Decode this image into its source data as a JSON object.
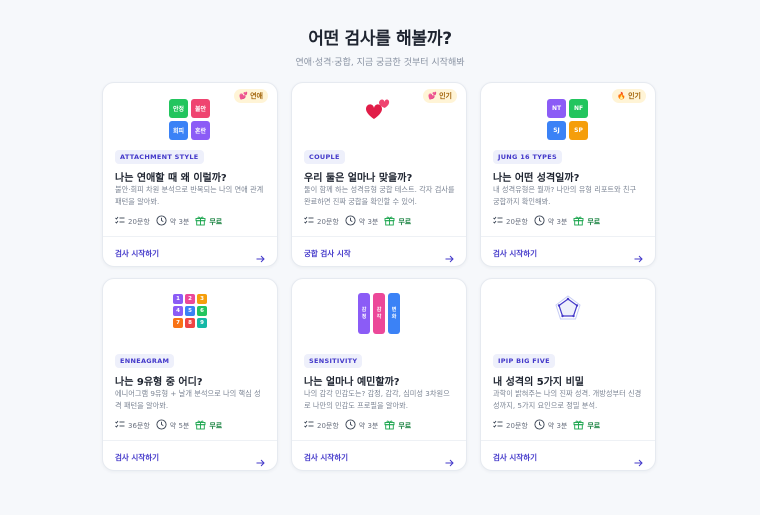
{
  "header": {
    "title": "어떤 검사를 해볼까?",
    "subtitle": "연애·성격·궁합, 지금 궁금한 것부터 시작해봐"
  },
  "colors": {
    "accent": "#4338ca",
    "free": "#15803d",
    "badge_bg": "#fff4d6"
  },
  "cards": [
    {
      "badge": "💕 연애",
      "art_icon": "attachment-grid-icon",
      "art_labels": [
        "안정",
        "불안",
        "회피",
        "혼란"
      ],
      "tag": "ATTACHMENT STYLE",
      "title": "나는 연애할 때 왜 이럴까?",
      "desc": "불안·회피 차원 분석으로 반복되는 나의 연애 관계 패턴을 알아봐.",
      "questions": "20문항",
      "time": "약 3분",
      "price": "무료",
      "cta": "검사 시작하기"
    },
    {
      "badge": "💕 인기",
      "art_icon": "two-hearts-icon",
      "tag": "COUPLE",
      "title": "우리 둘은 얼마나 맞을까?",
      "desc": "둘이 함께 하는 성격유형 궁합 테스트. 각자 검사를 완료하면 진짜 궁합을 확인할 수 있어.",
      "questions": "20문항",
      "time": "약 3분",
      "price": "무료",
      "cta": "궁합 검사 시작"
    },
    {
      "badge": "🔥 인기",
      "art_icon": "jung-grid-icon",
      "art_labels": [
        "NT",
        "NF",
        "SJ",
        "SP"
      ],
      "tag": "JUNG 16 TYPES",
      "title": "나는 어떤 성격일까?",
      "desc": "내 성격유형은 뭘까? 나만의 유형 리포트와 친구 궁합까지 확인해봐.",
      "questions": "20문항",
      "time": "약 3분",
      "price": "무료",
      "cta": "검사 시작하기"
    },
    {
      "art_icon": "enneagram-grid-icon",
      "art_labels": [
        "1",
        "2",
        "3",
        "4",
        "5",
        "6",
        "7",
        "8",
        "9"
      ],
      "tag": "ENNEAGRAM",
      "title": "나는 9유형 중 어디?",
      "desc": "에니어그램 9유형 + 날개 분석으로 나의 핵심 성격 패턴을 알아봐.",
      "questions": "36문항",
      "time": "약 5분",
      "price": "무료",
      "cta": "검사 시작하기"
    },
    {
      "art_icon": "sensitivity-bars-icon",
      "art_labels": [
        "감정",
        "감각",
        "변화"
      ],
      "tag": "SENSITIVITY",
      "title": "나는 얼마나 예민할까?",
      "desc": "나의 감각 민감도는? 감정, 감각, 심미성 3차원으로 나만의 민감도 프로필을 알아봐.",
      "questions": "20문항",
      "time": "약 3분",
      "price": "무료",
      "cta": "검사 시작하기"
    },
    {
      "art_icon": "pentagon-radar-icon",
      "tag": "IPIP BIG FIVE",
      "title": "내 성격의 5가지 비밀",
      "desc": "과학이 밝혀주는 나의 진짜 성격. 개방성부터 신경성까지, 5가지 요인으로 정밀 분석.",
      "questions": "20문항",
      "time": "약 3분",
      "price": "무료",
      "cta": "검사 시작하기"
    }
  ]
}
